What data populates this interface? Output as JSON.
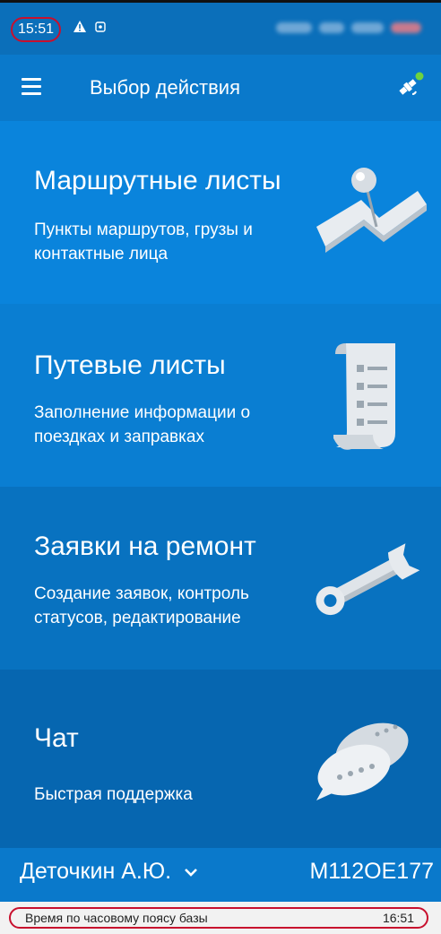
{
  "status_bar": {
    "time": "15:51",
    "icons": [
      "warning-icon",
      "notification-icon"
    ]
  },
  "app_bar": {
    "title": "Выбор действия",
    "menu_icon": "hamburger-menu-icon",
    "status_icon": "satellite-online-icon"
  },
  "menu": [
    {
      "title": "Маршрутные листы",
      "subtitle": "Пункты маршрутов, грузы и контактные лица",
      "icon": "map-pin-icon",
      "color": "#0a84dc"
    },
    {
      "title": "Путевые листы",
      "subtitle": "Заполнение информации о поездках и заправках",
      "icon": "document-scroll-icon",
      "color": "#0a7ed2"
    },
    {
      "title": "Заявки на ремонт",
      "subtitle": "Создание заявок, контроль статусов, редактирование",
      "icon": "wrench-icon",
      "color": "#0872c0"
    },
    {
      "title": "Чат",
      "subtitle": "Быстрая поддержка",
      "icon": "chat-bubbles-icon",
      "color": "#0666b0"
    }
  ],
  "footer": {
    "driver_name": "Деточкин А.Ю.",
    "vehicle_plate": "М112ОЕ177"
  },
  "timezone_bar": {
    "label": "Время по часовому поясу базы",
    "time": "16:51"
  }
}
